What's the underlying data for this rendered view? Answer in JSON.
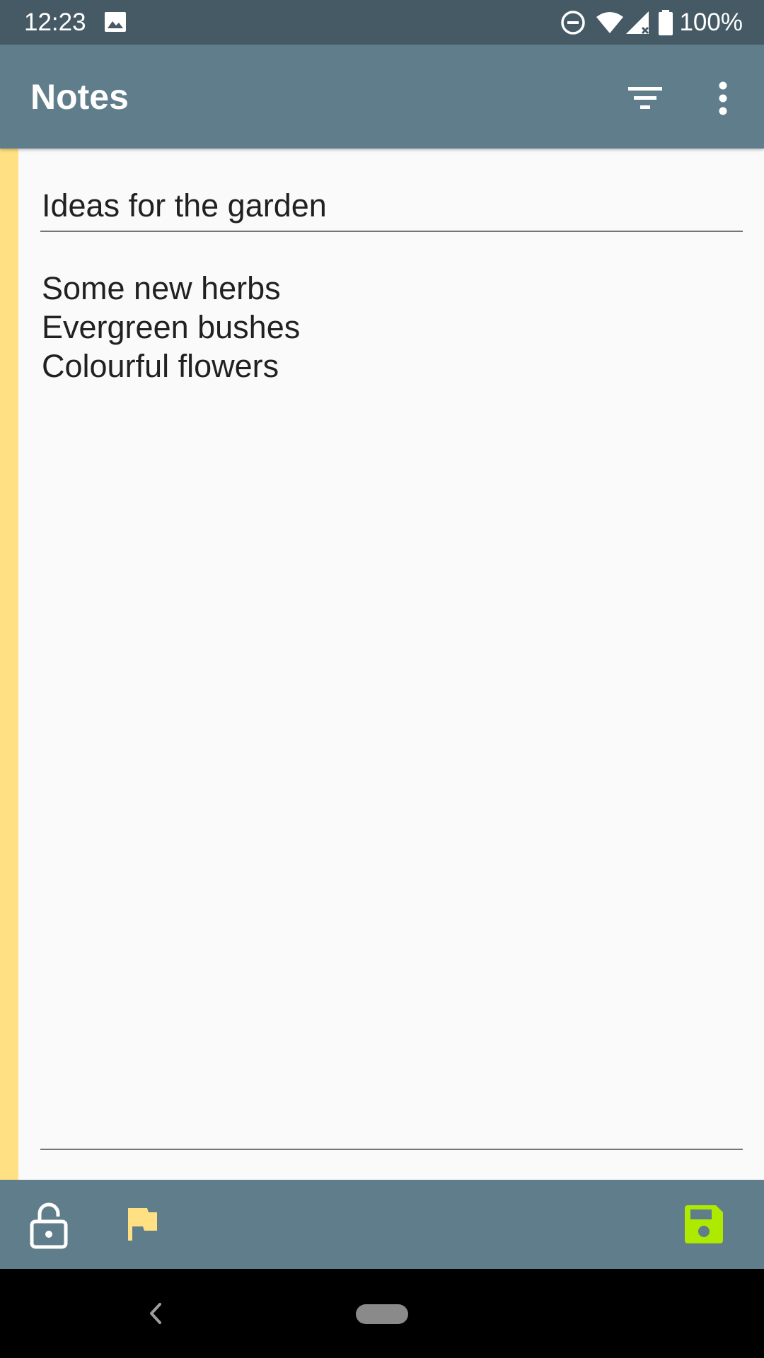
{
  "status_bar": {
    "time": "12:23",
    "battery_text": "100%",
    "icons": [
      "image-icon",
      "do-not-disturb-icon",
      "wifi-icon",
      "cell-signal-icon",
      "battery-icon"
    ]
  },
  "app_bar": {
    "title": "Notes",
    "icons": [
      "filter-icon",
      "more-vert-icon"
    ]
  },
  "note": {
    "color": "#ffe082",
    "title": "Ideas for the garden",
    "body_lines": [
      "Some new herbs",
      "Evergreen bushes",
      "Colourful flowers"
    ]
  },
  "bottom_bar": {
    "icons": [
      "lock-open-icon",
      "flag-icon",
      "save-icon"
    ],
    "flag_color": "#ffe082",
    "save_color": "#aeea00"
  },
  "colors": {
    "status_bar": "#455a64",
    "app_bar": "#607d8b",
    "background": "#fafafa"
  },
  "nav_bar": {
    "icons": [
      "back-icon",
      "home-pill-icon"
    ]
  }
}
